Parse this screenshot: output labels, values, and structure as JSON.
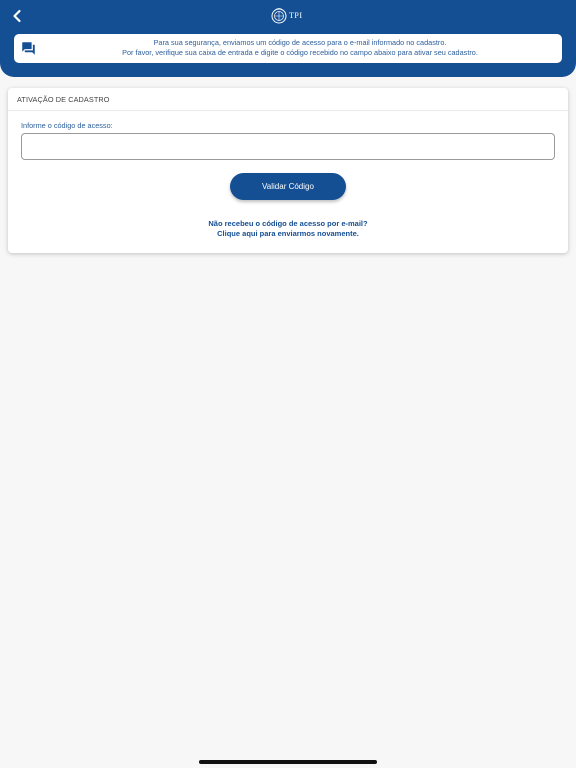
{
  "header": {
    "back_icon": "chevron-left-icon",
    "logo_icon": "crest-emblem-icon",
    "logo_text": "TPI",
    "colors": {
      "primary": "#154f93",
      "text_blue": "#2d5f9a"
    }
  },
  "notice": {
    "icon": "chat-bubbles-icon",
    "line1": "Para sua segurança, enviamos um código de acesso para o e-mail informado no cadastro.",
    "line2": "Por favor, verifique sua caixa de entrada e digite o código recebido no campo abaixo para ativar seu cadastro."
  },
  "card": {
    "title": "ATIVAÇÃO DE CADASTRO",
    "field_label": "Informe o código de acesso:",
    "field_value": "",
    "button_label": "Validar Código",
    "resend_line1": "Não recebeu o código de acesso por e-mail?",
    "resend_line2": "Clique aqui para enviarmos novamente."
  }
}
